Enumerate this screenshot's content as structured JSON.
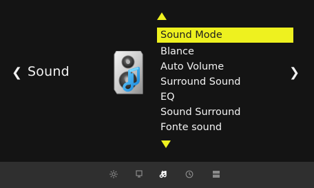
{
  "page": {
    "left_arrow": "❮",
    "right_arrow": "❯",
    "title": "Sound"
  },
  "menu": {
    "items": [
      {
        "label": "Sound Mode",
        "selected": true
      },
      {
        "label": "Blance",
        "selected": false
      },
      {
        "label": "Auto Volume",
        "selected": false
      },
      {
        "label": "Surround Sound",
        "selected": false
      },
      {
        "label": "EQ",
        "selected": false
      },
      {
        "label": "Sound Surround",
        "selected": false
      },
      {
        "label": "Fonte sound",
        "selected": false
      }
    ]
  },
  "tabs": [
    {
      "name": "settings",
      "icon": "gear-icon",
      "active": false
    },
    {
      "name": "screen",
      "icon": "monitor-icon",
      "active": false
    },
    {
      "name": "sound",
      "icon": "music-note-icon",
      "active": true
    },
    {
      "name": "time",
      "icon": "clock-icon",
      "active": false
    },
    {
      "name": "lock",
      "icon": "panel-icon",
      "active": false
    }
  ],
  "colors": {
    "background": "#141414",
    "highlight": "#eef11f",
    "text": "#f2f2f2",
    "bottom_bar": "#2f2f2f",
    "icon_inactive": "#8b8b8b",
    "icon_active": "#ffffff"
  }
}
